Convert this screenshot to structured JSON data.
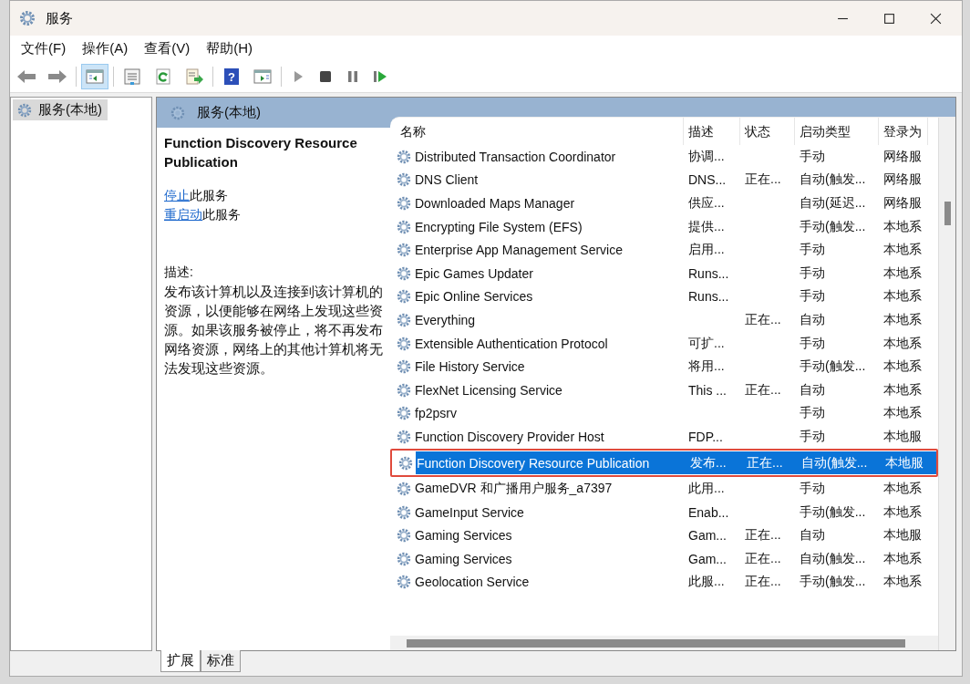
{
  "window": {
    "title": "服务"
  },
  "menu": [
    {
      "label": "文件(F)"
    },
    {
      "label": "操作(A)"
    },
    {
      "label": "查看(V)"
    },
    {
      "label": "帮助(H)"
    }
  ],
  "toolbar": {
    "console_tree_pressed": true,
    "help_glyph": "?"
  },
  "tree": {
    "items": [
      {
        "label": "服务(本地)",
        "selected": true
      }
    ]
  },
  "panel": {
    "title": "服务(本地)"
  },
  "detail": {
    "title": "Function Discovery Resource Publication",
    "actions": [
      {
        "link": "停止",
        "text": "此服务"
      },
      {
        "link": "重启动",
        "text": "此服务"
      }
    ],
    "description_label": "描述:",
    "description": "发布该计算机以及连接到该计算机的资源，以便能够在网络上发现这些资源。如果该服务被停止，将不再发布网络资源，网络上的其他计算机将无法发现这些资源。"
  },
  "table": {
    "columns": [
      "名称",
      "描述",
      "状态",
      "启动类型",
      "登录为"
    ],
    "rows": [
      {
        "name": "Distributed Transaction Coordinator",
        "description": "协调...",
        "status": "",
        "startup": "手动",
        "logon": "网络服",
        "selected": false
      },
      {
        "name": "DNS Client",
        "description": "DNS...",
        "status": "正在...",
        "startup": "自动(触发...",
        "logon": "网络服",
        "selected": false
      },
      {
        "name": "Downloaded Maps Manager",
        "description": "供应...",
        "status": "",
        "startup": "自动(延迟...",
        "logon": "网络服",
        "selected": false
      },
      {
        "name": "Encrypting File System (EFS)",
        "description": "提供...",
        "status": "",
        "startup": "手动(触发...",
        "logon": "本地系",
        "selected": false
      },
      {
        "name": "Enterprise App Management Service",
        "description": "启用...",
        "status": "",
        "startup": "手动",
        "logon": "本地系",
        "selected": false
      },
      {
        "name": "Epic Games Updater",
        "description": "Runs...",
        "status": "",
        "startup": "手动",
        "logon": "本地系",
        "selected": false
      },
      {
        "name": "Epic Online Services",
        "description": "Runs...",
        "status": "",
        "startup": "手动",
        "logon": "本地系",
        "selected": false
      },
      {
        "name": "Everything",
        "description": "",
        "status": "正在...",
        "startup": "自动",
        "logon": "本地系",
        "selected": false
      },
      {
        "name": "Extensible Authentication Protocol",
        "description": "可扩...",
        "status": "",
        "startup": "手动",
        "logon": "本地系",
        "selected": false
      },
      {
        "name": "File History Service",
        "description": "将用...",
        "status": "",
        "startup": "手动(触发...",
        "logon": "本地系",
        "selected": false
      },
      {
        "name": "FlexNet Licensing Service",
        "description": "This ...",
        "status": "正在...",
        "startup": "自动",
        "logon": "本地系",
        "selected": false
      },
      {
        "name": "fp2psrv",
        "description": "",
        "status": "",
        "startup": "手动",
        "logon": "本地系",
        "selected": false
      },
      {
        "name": "Function Discovery Provider Host",
        "description": "FDP...",
        "status": "",
        "startup": "手动",
        "logon": "本地服",
        "selected": false
      },
      {
        "name": "Function Discovery Resource Publication",
        "description": "发布...",
        "status": "正在...",
        "startup": "自动(触发...",
        "logon": "本地服",
        "selected": true
      },
      {
        "name": "GameDVR 和广播用户服务_a7397",
        "description": "此用...",
        "status": "",
        "startup": "手动",
        "logon": "本地系",
        "selected": false
      },
      {
        "name": "GameInput Service",
        "description": "Enab...",
        "status": "",
        "startup": "手动(触发...",
        "logon": "本地系",
        "selected": false
      },
      {
        "name": "Gaming Services",
        "description": "Gam...",
        "status": "正在...",
        "startup": "自动",
        "logon": "本地服",
        "selected": false
      },
      {
        "name": "Gaming Services",
        "description": "Gam...",
        "status": "正在...",
        "startup": "自动(触发...",
        "logon": "本地系",
        "selected": false
      },
      {
        "name": "Geolocation Service",
        "description": "此服...",
        "status": "正在...",
        "startup": "手动(触发...",
        "logon": "本地系",
        "selected": false
      }
    ]
  },
  "tabs": [
    {
      "label": "扩展",
      "selected": true
    },
    {
      "label": "标准",
      "selected": false
    }
  ]
}
